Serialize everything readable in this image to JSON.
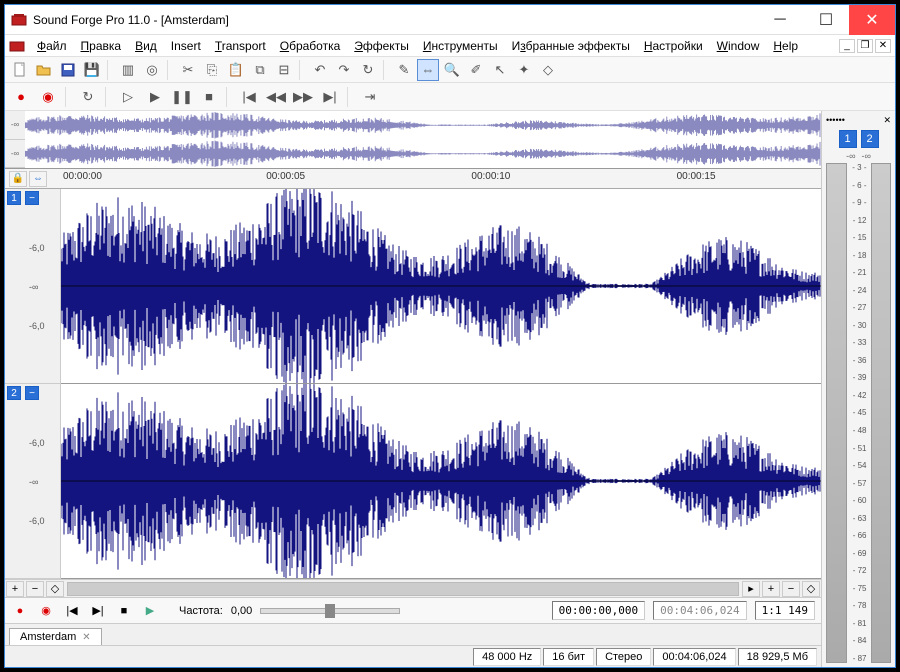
{
  "window": {
    "title": "Sound Forge Pro 11.0 - [Amsterdam]"
  },
  "menu": {
    "items": [
      "Файл",
      "Правка",
      "Вид",
      "Insert",
      "Transport",
      "Обработка",
      "Эффекты",
      "Инструменты",
      "Избранные эффекты",
      "Настройки",
      "Window",
      "Help"
    ]
  },
  "ruler": {
    "ticks": [
      "00:00:00",
      "00:00:05",
      "00:00:10",
      "00:00:15"
    ]
  },
  "channels": {
    "ch1": "1",
    "ch2": "2",
    "db_upper": "-6,0",
    "db_mid": "-∞",
    "db_lower": "-6,0"
  },
  "bottom": {
    "rate_label": "Частота:",
    "rate_value": "0,00",
    "time_pos": "00:00:00,000",
    "time_end": "00:04:06,024",
    "ratio": "1:1 149"
  },
  "tab": {
    "name": "Amsterdam"
  },
  "status": {
    "samplerate": "48 000 Hz",
    "bitdepth": "16 бит",
    "channels": "Стерео",
    "duration": "00:04:06,024",
    "memory": "18 929,5 Мб"
  },
  "meters": {
    "title": "••••••",
    "ch1": "1",
    "ch2": "2",
    "inf1": "-∞",
    "inf2": "-∞",
    "scale": [
      "- 3 -",
      "- 6 -",
      "- 9 -",
      "- 12",
      "- 15",
      "- 18",
      "- 21",
      "- 24",
      "- 27",
      "- 30",
      "- 33",
      "- 36",
      "- 39",
      "- 42",
      "- 45",
      "- 48",
      "- 51",
      "- 54",
      "- 57",
      "- 60",
      "- 63",
      "- 66",
      "- 69",
      "- 72",
      "- 75",
      "- 78",
      "- 81",
      "- 84",
      "- 87"
    ]
  }
}
